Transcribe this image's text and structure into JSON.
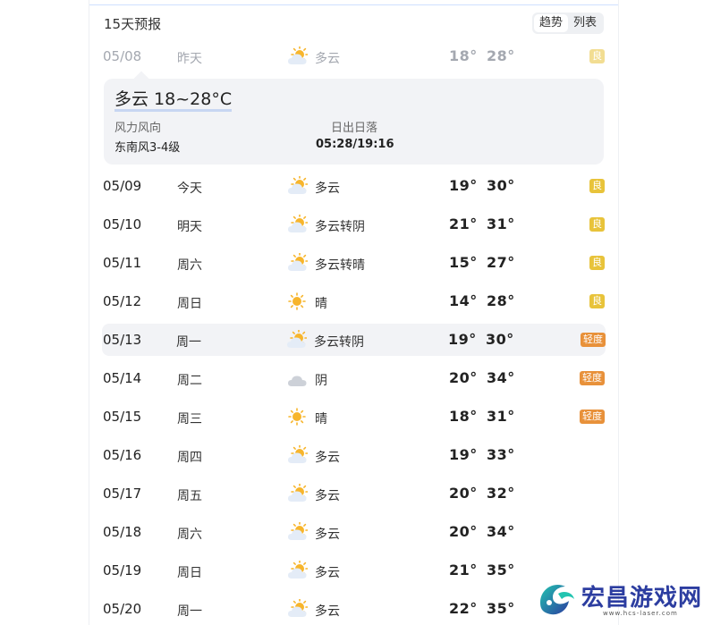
{
  "header": {
    "title": "15天预报",
    "toggle": [
      {
        "label": "趋势",
        "active": true
      },
      {
        "label": "列表",
        "active": false
      }
    ]
  },
  "detail": {
    "summary": "多云 18~28°C",
    "wind_label": "风力风向",
    "wind_value": "东南风3-4级",
    "sun_label": "日出日落",
    "sun_value": "05:28/19:16"
  },
  "aqi_colors": {
    "good": "#e8c33a",
    "light": "#e8913a"
  },
  "rows": [
    {
      "date": "05/08",
      "day": "昨天",
      "icon": "partly-cloudy-icon",
      "desc": "多云",
      "low": "18°",
      "high": "28°",
      "aqi": "良",
      "aqi_level": "good"
    },
    {
      "date": "05/09",
      "day": "今天",
      "icon": "partly-cloudy-icon",
      "desc": "多云",
      "low": "19°",
      "high": "30°",
      "aqi": "良",
      "aqi_level": "good"
    },
    {
      "date": "05/10",
      "day": "明天",
      "icon": "partly-cloudy-icon",
      "desc": "多云转阴",
      "low": "21°",
      "high": "31°",
      "aqi": "良",
      "aqi_level": "good"
    },
    {
      "date": "05/11",
      "day": "周六",
      "icon": "partly-cloudy-icon",
      "desc": "多云转晴",
      "low": "15°",
      "high": "27°",
      "aqi": "良",
      "aqi_level": "good"
    },
    {
      "date": "05/12",
      "day": "周日",
      "icon": "sunny-icon",
      "desc": "晴",
      "low": "14°",
      "high": "28°",
      "aqi": "良",
      "aqi_level": "good"
    },
    {
      "date": "05/13",
      "day": "周一",
      "icon": "partly-cloudy-icon",
      "desc": "多云转阴",
      "low": "19°",
      "high": "30°",
      "aqi": "轻度",
      "aqi_level": "light"
    },
    {
      "date": "05/14",
      "day": "周二",
      "icon": "overcast-icon",
      "desc": "阴",
      "low": "20°",
      "high": "34°",
      "aqi": "轻度",
      "aqi_level": "light"
    },
    {
      "date": "05/15",
      "day": "周三",
      "icon": "sunny-icon",
      "desc": "晴",
      "low": "18°",
      "high": "31°",
      "aqi": "轻度",
      "aqi_level": "light"
    },
    {
      "date": "05/16",
      "day": "周四",
      "icon": "partly-cloudy-icon",
      "desc": "多云",
      "low": "19°",
      "high": "33°",
      "aqi": "",
      "aqi_level": ""
    },
    {
      "date": "05/17",
      "day": "周五",
      "icon": "partly-cloudy-icon",
      "desc": "多云",
      "low": "20°",
      "high": "32°",
      "aqi": "",
      "aqi_level": ""
    },
    {
      "date": "05/18",
      "day": "周六",
      "icon": "partly-cloudy-icon",
      "desc": "多云",
      "low": "20°",
      "high": "34°",
      "aqi": "",
      "aqi_level": ""
    },
    {
      "date": "05/19",
      "day": "周日",
      "icon": "partly-cloudy-icon",
      "desc": "多云",
      "low": "21°",
      "high": "35°",
      "aqi": "",
      "aqi_level": ""
    },
    {
      "date": "05/20",
      "day": "周一",
      "icon": "partly-cloudy-icon",
      "desc": "多云",
      "low": "22°",
      "high": "35°",
      "aqi": "",
      "aqi_level": ""
    }
  ],
  "watermark": {
    "name": "宏昌游戏网",
    "url": "www.hcs-laser.com"
  }
}
